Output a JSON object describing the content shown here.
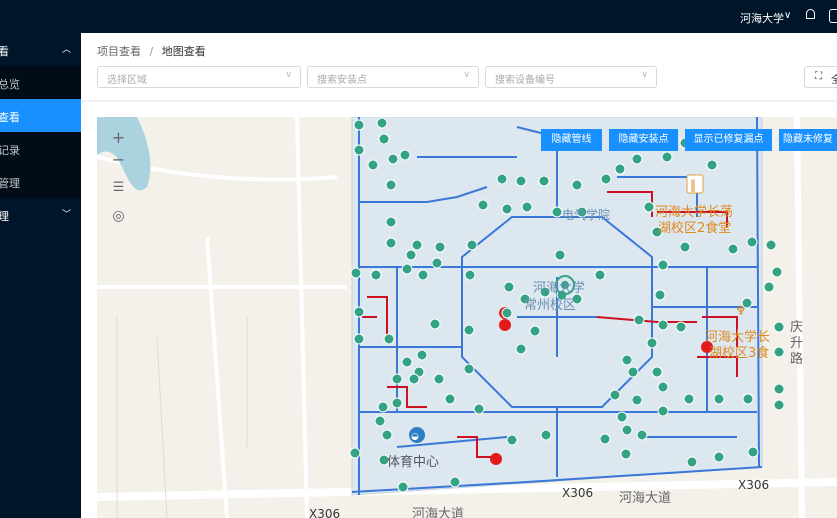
{
  "header": {
    "user_name": "河海大学",
    "caret": "∨"
  },
  "sidebar": {
    "group1": {
      "label": "看",
      "chevron": "︿"
    },
    "items": [
      {
        "label": "总览"
      },
      {
        "label": "查看"
      },
      {
        "label": "记录"
      },
      {
        "label": "管理"
      }
    ],
    "group2": {
      "label": "理",
      "chevron": "﹀"
    }
  },
  "breadcrumb": {
    "parent": "项目查看",
    "separator": "/",
    "current": "地图查看"
  },
  "filters": {
    "area": "选择区域",
    "install_point": "搜索安装点",
    "device_id": "搜索设备编号"
  },
  "fullscreen": {
    "icon": "⛶",
    "label": "全"
  },
  "map_buttons": {
    "hide_pipeline": "隐藏管线",
    "hide_install_points": "隐藏安装点",
    "show_repaired_leaks": "显示已修复漏点",
    "hide_unrepaired": "隐藏未修复"
  },
  "map_controls": {
    "zoom_in": "+",
    "zoom_out": "−",
    "list": "☰",
    "locate": "◎"
  },
  "map_labels": {
    "college": "电气学院",
    "canteen2_line1": "河海大学长荡",
    "canteen2_line2": "湖校区2食堂",
    "campus_line1": "河海大学",
    "campus_line2": "常州校区",
    "canteen3_line1": "河海大学长",
    "canteen3_line2": "湖校区3食",
    "sports_center": "体育中心",
    "road_x306_a": "X306",
    "road_x306_b": "X306",
    "road_x306_c": "X306",
    "hehai_road_a": "河海大道",
    "hehai_road_b": "河海大道",
    "qing_1": "庆",
    "qing_2": "升",
    "qing_3": "路"
  },
  "colors": {
    "header_bg": "#001529",
    "active_blue": "#1890ff",
    "pipe": "#3a78d8",
    "leak_line": "#cc1122",
    "marker": "#33a383",
    "leak_marker": "#e31b1b",
    "campus_fill": "#dce7ef"
  }
}
